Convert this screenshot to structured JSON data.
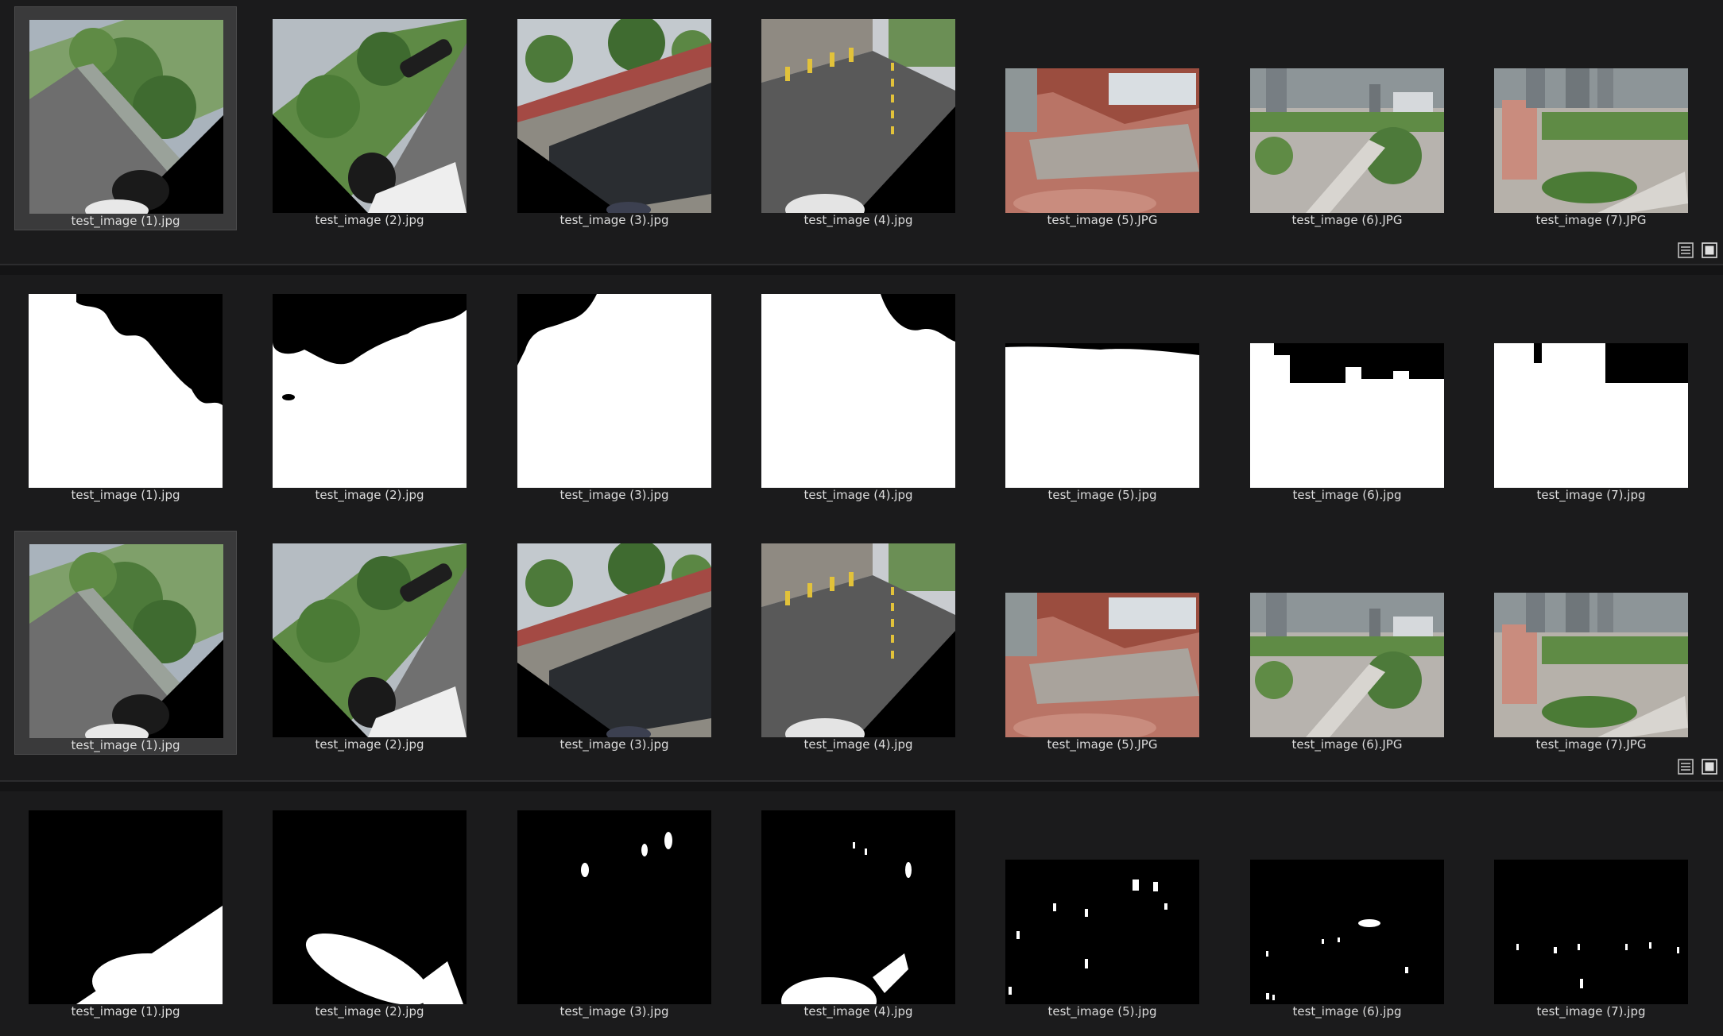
{
  "panels": [
    {
      "id": "panel1",
      "rows": [
        {
          "kind": "photo",
          "tiles": [
            {
              "caption": "test_image (1).jpg",
              "scene": "tilt-left",
              "selected": true
            },
            {
              "caption": "test_image (2).jpg",
              "scene": "tilt-right"
            },
            {
              "caption": "test_image (3).jpg",
              "scene": "glass"
            },
            {
              "caption": "test_image (4).jpg",
              "scene": "road"
            },
            {
              "caption": "test_image (5).JPG",
              "scene": "plaza"
            },
            {
              "caption": "test_image (6).JPG",
              "scene": "park"
            },
            {
              "caption": "test_image (7).JPG",
              "scene": "park2"
            }
          ]
        }
      ],
      "view_buttons": [
        {
          "icon": "list-view-icon"
        },
        {
          "icon": "thumbnail-view-icon"
        }
      ]
    },
    {
      "id": "panel2",
      "rows": [
        {
          "kind": "sky-mask",
          "tiles": [
            {
              "caption": "test_image (1).jpg",
              "mask": "sky1"
            },
            {
              "caption": "test_image (2).jpg",
              "mask": "sky2"
            },
            {
              "caption": "test_image (3).jpg",
              "mask": "sky3"
            },
            {
              "caption": "test_image (4).jpg",
              "mask": "sky4"
            },
            {
              "caption": "test_image (5).jpg",
              "mask": "sky5"
            },
            {
              "caption": "test_image (6).jpg",
              "mask": "sky6"
            },
            {
              "caption": "test_image (7).jpg",
              "mask": "sky7"
            }
          ]
        },
        {
          "kind": "photo",
          "tiles": [
            {
              "caption": "test_image (1).jpg",
              "scene": "tilt-left",
              "selected": true
            },
            {
              "caption": "test_image (2).jpg",
              "scene": "tilt-right"
            },
            {
              "caption": "test_image (3).jpg",
              "scene": "glass"
            },
            {
              "caption": "test_image (4).jpg",
              "scene": "road"
            },
            {
              "caption": "test_image (5).JPG",
              "scene": "plaza"
            },
            {
              "caption": "test_image (6).JPG",
              "scene": "park"
            },
            {
              "caption": "test_image (7).JPG",
              "scene": "park2"
            }
          ]
        }
      ],
      "view_buttons": [
        {
          "icon": "list-view-icon"
        },
        {
          "icon": "thumbnail-view-icon"
        }
      ]
    },
    {
      "id": "panel3",
      "rows": [
        {
          "kind": "object-mask",
          "tiles": [
            {
              "caption": "test_image (1).jpg",
              "mask": "obj1"
            },
            {
              "caption": "test_image (2).jpg",
              "mask": "obj2"
            },
            {
              "caption": "test_image (3).jpg",
              "mask": "obj3"
            },
            {
              "caption": "test_image (4).jpg",
              "mask": "obj4"
            },
            {
              "caption": "test_image (5).jpg",
              "mask": "obj5"
            },
            {
              "caption": "test_image (6).jpg",
              "mask": "obj6"
            },
            {
              "caption": "test_image (7).jpg",
              "mask": "obj7"
            }
          ]
        }
      ]
    }
  ]
}
